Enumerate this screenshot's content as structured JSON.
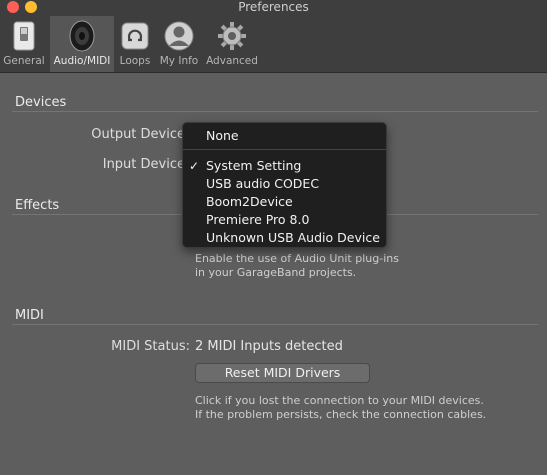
{
  "window": {
    "title": "Preferences"
  },
  "toolbar": {
    "items": [
      {
        "label": "General"
      },
      {
        "label": "Audio/MIDI"
      },
      {
        "label": "Loops"
      },
      {
        "label": "My Info"
      },
      {
        "label": "Advanced"
      }
    ]
  },
  "devices": {
    "title": "Devices",
    "output_label": "Output Device",
    "input_label": "Input Device"
  },
  "effects": {
    "title": "Effects",
    "help_line1": "Enable the use of Audio Unit plug-ins",
    "help_line2": "in your GarageBand projects."
  },
  "midi": {
    "title": "MIDI",
    "status_label": "MIDI Status:",
    "status_value": "2 MIDI Inputs detected",
    "reset_button": "Reset MIDI Drivers",
    "help_line1": "Click if you lost the connection to your MIDI devices.",
    "help_line2": "If the problem persists, check the connection cables."
  },
  "dropdown": {
    "items": [
      {
        "label": "None",
        "checked": false
      },
      {
        "label": "System Setting",
        "checked": true,
        "check": "✓"
      },
      {
        "label": "USB audio CODEC",
        "checked": false
      },
      {
        "label": "Boom2Device",
        "checked": false
      },
      {
        "label": "Premiere Pro 8.0",
        "checked": false
      },
      {
        "label": "Unknown USB Audio Device",
        "checked": false
      }
    ]
  }
}
